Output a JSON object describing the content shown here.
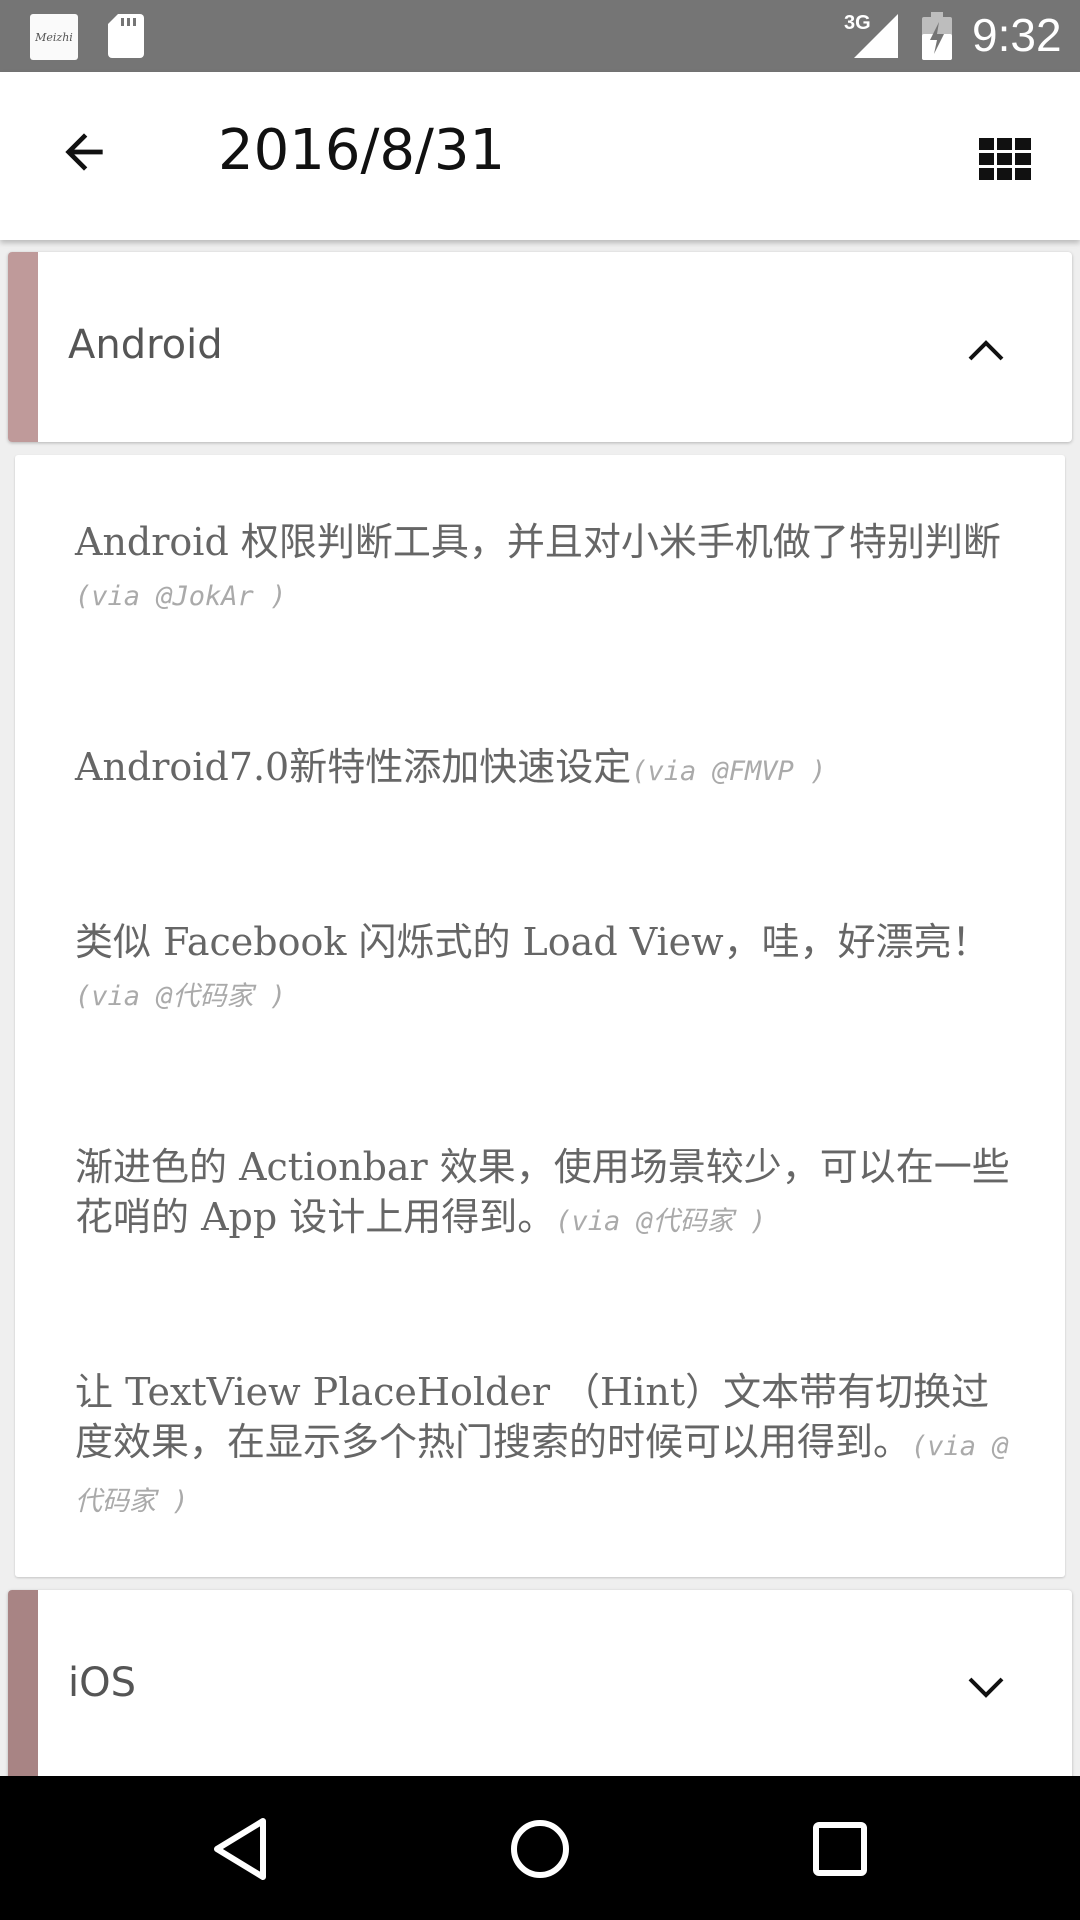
{
  "status_bar": {
    "app_icon_text": "Meizhi",
    "network_label": "3G",
    "time": "9:32"
  },
  "app_bar": {
    "title": "2016/8/31",
    "back_icon": "arrow-back-icon",
    "menu_icon": "grid-icon"
  },
  "categories": [
    {
      "label": "Android",
      "expanded": true,
      "stripe_color": "#bf9a9a"
    },
    {
      "label": "iOS",
      "expanded": false,
      "stripe_color": "#a88484"
    }
  ],
  "items": [
    {
      "text": "Android 权限判断工具，并且对小米手机做了特别判断",
      "via": "(via @JokAr )"
    },
    {
      "text": "Android7.0新特性添加快速设定",
      "via": "(via @FMVP )"
    },
    {
      "text": "类似 Facebook 闪烁式的 Load View，哇，好漂亮！",
      "via": "(via @代码家 )"
    },
    {
      "text": "渐进色的 Actionbar 效果，使用场景较少，可以在一些花哨的 App 设计上用得到。",
      "via": "(via @代码家 )"
    },
    {
      "text": "让 TextView PlaceHolder （Hint）文本带有切换过度效果，在显示多个热门搜索的时候可以用得到。",
      "via": "(via @代码家 )"
    }
  ],
  "nav_bar": {
    "back_icon": "nav-back-icon",
    "home_icon": "nav-home-icon",
    "recents_icon": "nav-recents-icon"
  }
}
